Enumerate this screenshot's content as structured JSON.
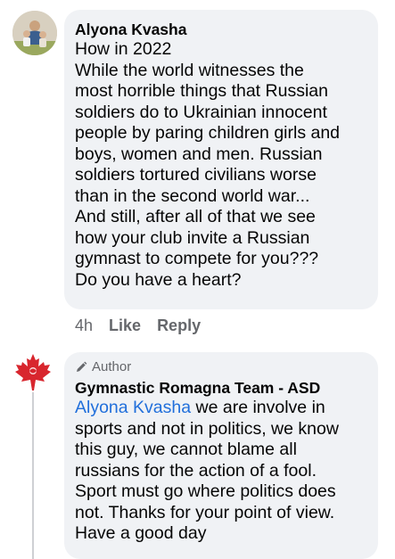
{
  "comment1": {
    "author": "Alyona Kvasha",
    "lines": [
      "How in 2022",
      "While the world witnesses the",
      "most horrible things that Russian",
      "soldiers do to Ukrainian innocent",
      "people by paring children girls and",
      "boys, women and men. Russian",
      "soldiers tortured civilians worse",
      "than in the second world war...",
      "And still, after all of that we see",
      "how your club invite a Russian",
      "gymnast to compete for you???",
      "Do you have a heart?"
    ],
    "time": "4h",
    "like_label": "Like",
    "reply_label": "Reply"
  },
  "comment2": {
    "badge": "Author",
    "author": "Gymnastic Romagna Team - ASD",
    "mention": "Alyona Kvasha",
    "first_line_rest": " we are involve in",
    "lines": [
      "sports and not in politics, we know",
      "this guy, we cannot blame all",
      "russians for the action of a fool.",
      "Sport must go where politics does",
      "not. Thanks for your point of view.",
      "Have a good day"
    ]
  },
  "colors": {
    "bubble": "#f0f2f5",
    "mention": "#216fdb",
    "muted": "#65676b",
    "logo_red": "#d8262e"
  }
}
